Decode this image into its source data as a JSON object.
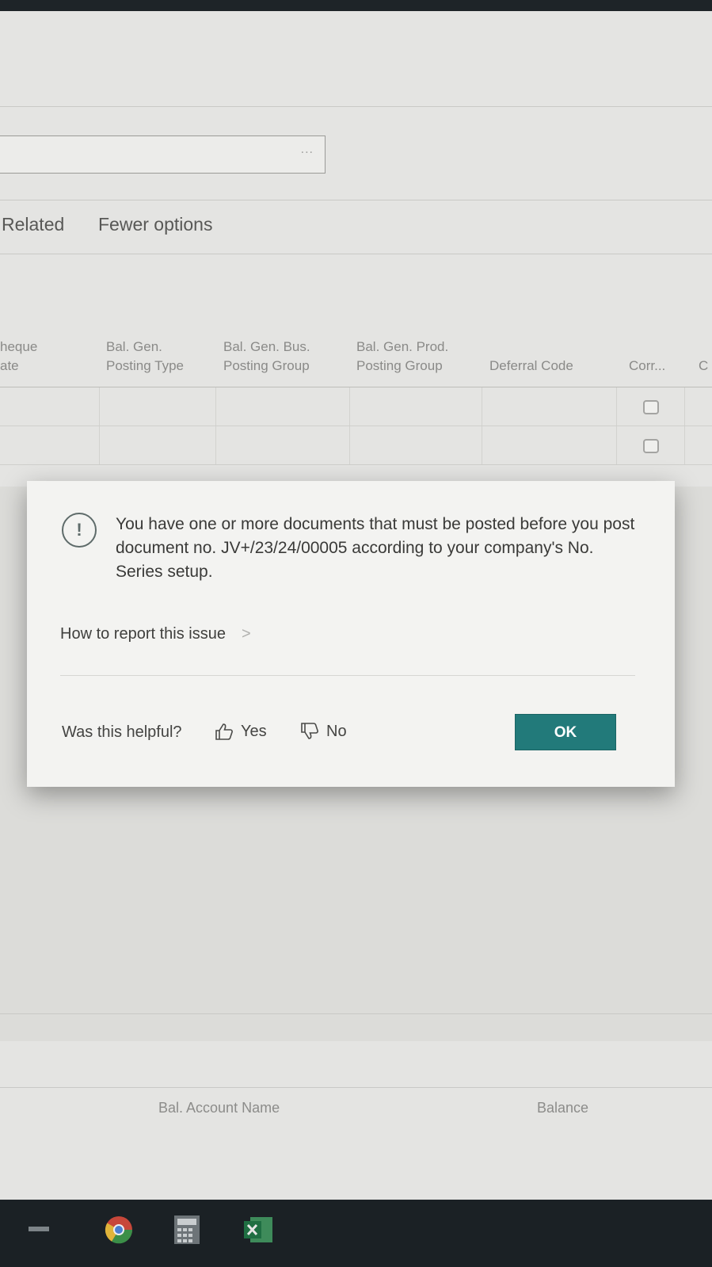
{
  "lookup_field": {
    "ellipsis": "..."
  },
  "actions": {
    "related": "Related",
    "fewer_options": "Fewer options"
  },
  "columns": [
    {
      "line1": "heque",
      "line2": "ate"
    },
    {
      "line1": "Bal. Gen.",
      "line2": "Posting Type"
    },
    {
      "line1": "Bal. Gen. Bus.",
      "line2": "Posting Group"
    },
    {
      "line1": "Bal. Gen. Prod.",
      "line2": "Posting Group"
    },
    {
      "line1": "",
      "line2": "Deferral Code"
    },
    {
      "line1": "",
      "line2": "Corr..."
    },
    {
      "line1": "",
      "line2": "C"
    }
  ],
  "dialog": {
    "message": "You have one or more documents that must be posted before you post document no. JV+/23/24/00005 according to your company's No. Series setup.",
    "report_link": "How to report this issue",
    "report_chevron": ">",
    "helpful_label": "Was this helpful?",
    "yes_label": "Yes",
    "no_label": "No",
    "ok_label": "OK",
    "icon_glyph": "!"
  },
  "footer": {
    "bal_account_name": "Bal. Account Name",
    "balance": "Balance"
  },
  "colors": {
    "accent": "#227a7a"
  }
}
